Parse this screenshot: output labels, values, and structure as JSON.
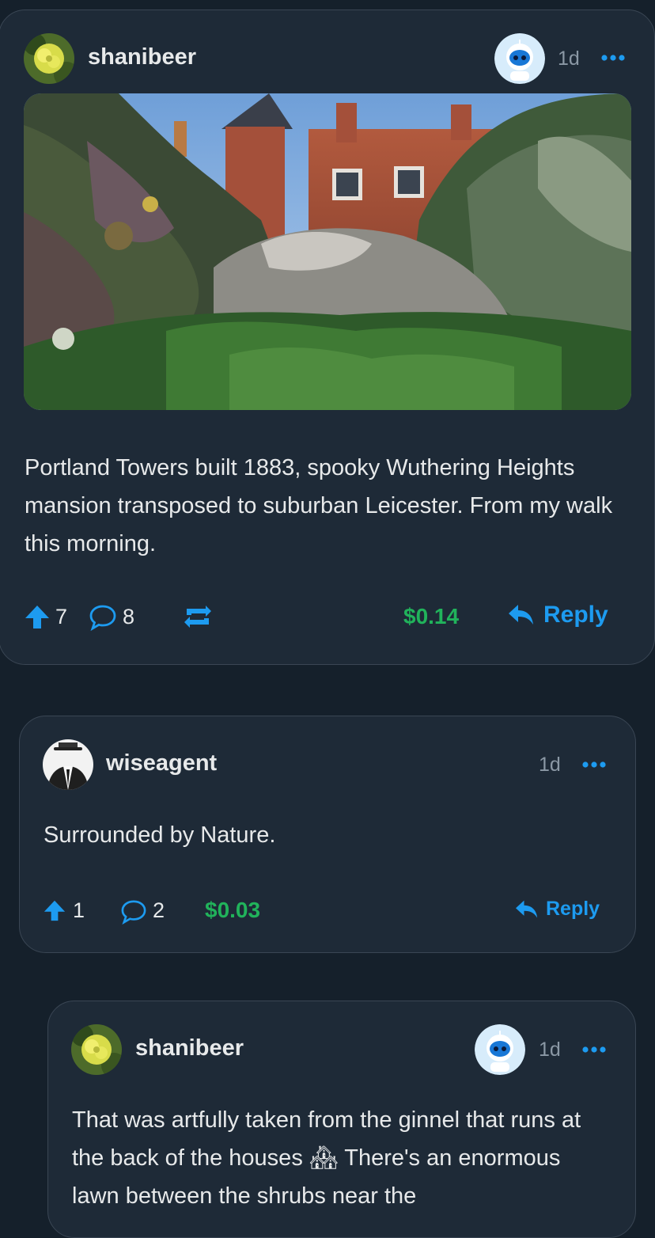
{
  "post": {
    "username": "shanibeer",
    "time": "1d",
    "text": "Portland Towers built 1883, spooky Wuthering Heights mansion transposed to suburban Leicester. From my walk this morning.",
    "upvotes": "7",
    "comments": "8",
    "payout": "$0.14",
    "reply_label": "Reply"
  },
  "comment1": {
    "username": "wiseagent",
    "time": "1d",
    "text": "Surrounded by Nature.",
    "upvotes": "1",
    "comments": "2",
    "payout": "$0.03",
    "reply_label": "Reply"
  },
  "comment2": {
    "username": "shanibeer",
    "time": "1d",
    "text_before_emoji": "That was artfully taken from the ginnel that runs at the back of the houses",
    "emoji": "🏘",
    "text_after_emoji": " There's an enormous lawn between the shrubs near the"
  },
  "colors": {
    "background": "#15202b",
    "card": "#1e2a37",
    "accent": "#1d9bf0",
    "money": "#21b35b",
    "muted": "#8b98a5"
  },
  "icons": [
    "upvote-arrow-icon",
    "comment-bubble-icon",
    "repost-icon",
    "reply-arrow-icon",
    "more-dots-icon",
    "robot-badge-icon"
  ]
}
